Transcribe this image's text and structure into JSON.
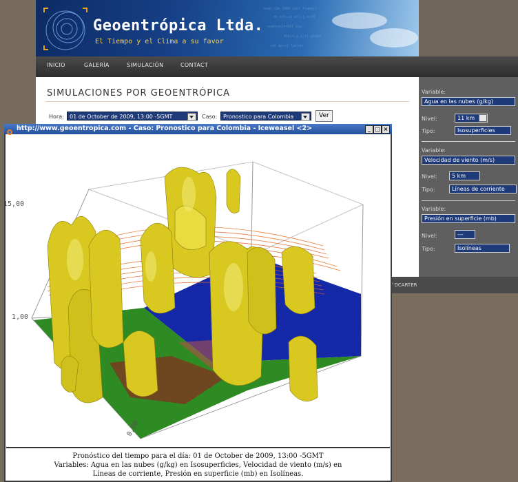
{
  "site": {
    "name": "Geoentrópica Ltda.",
    "tagline": "El Tiempo y el Clima a su favor"
  },
  "nav": [
    "INICIO",
    "GALERÍA",
    "SIMULACIÓN",
    "CONTACT"
  ],
  "page": {
    "title": "SIMULACIONES POR GEOENTRÓPICA",
    "hora_label": "Hora:",
    "hora_value": "01 de October de 2009, 13:00 -5GMT",
    "caso_label": "Caso:",
    "caso_value": "Pronostico para Colombia",
    "ver_button": "Ver"
  },
  "panel": [
    {
      "variable_label": "Variable:",
      "variable": "Agua en las nubes (g/kg)",
      "nivel_label": "Nivel:",
      "nivel": "11 km",
      "tipo_label": "Tipo:",
      "tipo": "Isosuperficies"
    },
    {
      "variable_label": "Variable:",
      "variable": "Velocidad de viento (m/s)",
      "nivel_label": "Nivel:",
      "nivel": "5 km",
      "tipo_label": "Tipo:",
      "tipo": "Líneas de corriente"
    },
    {
      "variable_label": "Variable:",
      "variable": "Presión en superficie (mb)",
      "nivel_label": "Nivel:",
      "nivel": "---",
      "tipo_label": "Tipo:",
      "tipo": "Isolíneas"
    }
  ],
  "footer_text": "Y DCARTER",
  "popup": {
    "title": "http://www.geoentropica.com - Caso: Pronostico para Colombia - Iceweasel <2>",
    "axis_labels": [
      "15,00",
      "1,00",
      "0,00"
    ],
    "caption_line1": "Pronóstico del tiempo para el día: 01 de October de 2009, 13:00 -5GMT",
    "caption_line2": "Variables: Agua en las nubes (g/kg) en Isosuperficies, Velocidad de viento (m/s) en",
    "caption_line3": "Líneas de corriente, Presión en superficie (mb) en Isolíneas."
  },
  "colors": {
    "header_dark": "#0d2b63",
    "select_bg": "#1e3a78",
    "cloud_yellow": "#d8c820",
    "streamline_orange": "#e8661c",
    "ocean_blue": "#1428a8",
    "land_green": "#2e8a22"
  }
}
